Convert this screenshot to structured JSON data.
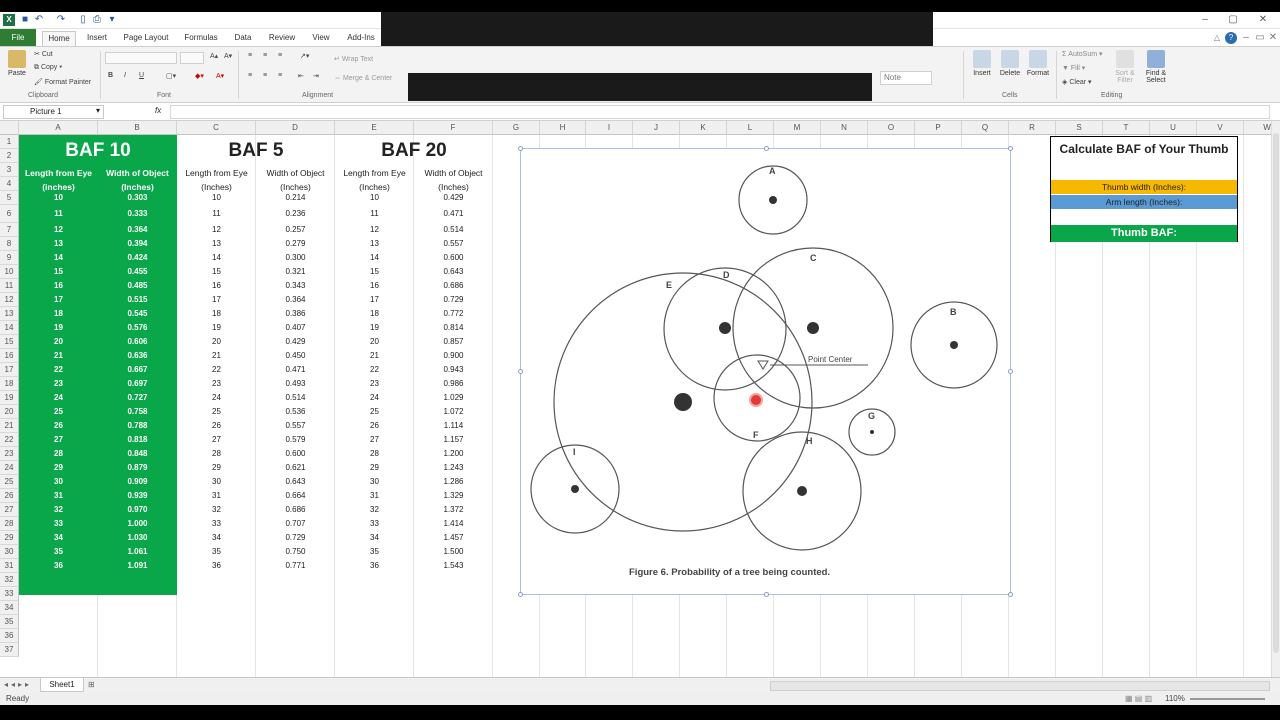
{
  "ribbon": {
    "tabs": [
      "File",
      "Home",
      "Insert",
      "Page Layout",
      "Formulas",
      "Data",
      "Review",
      "View",
      "Add-Ins"
    ],
    "clipboard": {
      "paste": "Paste",
      "cut": "Cut",
      "copy": "Copy",
      "format_painter": "Format Painter",
      "label": "Clipboard"
    },
    "font_label": "Font",
    "alignment": {
      "wrap": "Wrap Text",
      "merge": "Merge & Center",
      "label": "Alignment"
    },
    "number_note": "Note",
    "cells": {
      "insert": "Insert",
      "delete": "Delete",
      "format": "Format",
      "label": "Cells"
    },
    "editing": {
      "autosum": "AutoSum",
      "fill": "Fill",
      "clear": "Clear",
      "sort": "Sort & Filter",
      "find": "Find & Select",
      "label": "Editing"
    }
  },
  "formula": {
    "namebox": "Picture 1",
    "fx": "fx"
  },
  "columns": [
    "A",
    "B",
    "C",
    "D",
    "E",
    "F",
    "G",
    "H",
    "I",
    "J",
    "K",
    "L",
    "M",
    "N",
    "O",
    "P",
    "Q",
    "R",
    "S",
    "T",
    "U",
    "V",
    "W"
  ],
  "rows": [
    "1",
    "2",
    "3",
    "4",
    "5",
    "6",
    "7",
    "8",
    "9",
    "10",
    "11",
    "12",
    "13",
    "14",
    "15",
    "16",
    "17",
    "18",
    "19",
    "20",
    "21",
    "22",
    "23",
    "24",
    "25",
    "26",
    "27",
    "28",
    "29",
    "30",
    "31",
    "32",
    "33",
    "34",
    "35",
    "36",
    "37"
  ],
  "tables": {
    "baf10": {
      "title": "BAF 10",
      "h1": "Length from Eye",
      "h2": "Width of Object",
      "unit": "(inches)",
      "unit2": "(Inches)"
    },
    "baf5": {
      "title": "BAF 5",
      "h1": "Length from Eye",
      "h2": "Width of Object",
      "unit": "(Inches)",
      "unit2": "(Inches)"
    },
    "baf20": {
      "title": "BAF 20",
      "h1": "Length from Eye",
      "h2": "Width of Object",
      "unit": "(Inches)",
      "unit2": "(Inches)"
    },
    "lengths": [
      "10",
      "11",
      "12",
      "13",
      "14",
      "15",
      "16",
      "17",
      "18",
      "19",
      "20",
      "21",
      "22",
      "23",
      "24",
      "25",
      "26",
      "27",
      "28",
      "29",
      "30",
      "31",
      "32",
      "33",
      "34",
      "35",
      "36"
    ],
    "w10": [
      "0.303",
      "0.333",
      "0.364",
      "0.394",
      "0.424",
      "0.455",
      "0.485",
      "0.515",
      "0.545",
      "0.576",
      "0.606",
      "0.636",
      "0.667",
      "0.697",
      "0.727",
      "0.758",
      "0.788",
      "0.818",
      "0.848",
      "0.879",
      "0.909",
      "0.939",
      "0.970",
      "1.000",
      "1.030",
      "1.061",
      "1.091"
    ],
    "w5": [
      "0.214",
      "0.236",
      "0.257",
      "0.279",
      "0.300",
      "0.321",
      "0.343",
      "0.364",
      "0.386",
      "0.407",
      "0.429",
      "0.450",
      "0.471",
      "0.493",
      "0.514",
      "0.536",
      "0.557",
      "0.579",
      "0.600",
      "0.621",
      "0.643",
      "0.664",
      "0.686",
      "0.707",
      "0.729",
      "0.750",
      "0.771"
    ],
    "w20": [
      "0.429",
      "0.471",
      "0.514",
      "0.557",
      "0.600",
      "0.643",
      "0.686",
      "0.729",
      "0.772",
      "0.814",
      "0.857",
      "0.900",
      "0.943",
      "0.986",
      "1.029",
      "1.072",
      "1.114",
      "1.157",
      "1.200",
      "1.243",
      "1.286",
      "1.329",
      "1.372",
      "1.414",
      "1.457",
      "1.500",
      "1.543"
    ]
  },
  "figure": {
    "caption": "Figure 6. Probability of a tree being counted.",
    "point_center": "Point Center",
    "letters": [
      "A",
      "B",
      "C",
      "D",
      "E",
      "F",
      "G",
      "H",
      "I"
    ]
  },
  "calc": {
    "title": "Calculate BAF of Your Thumb",
    "thumb": "Thumb width (Inches):",
    "arm": "Arm length (Inches):",
    "result": "Thumb BAF:",
    "orange": "#f6b800",
    "blue": "#5b9bd5",
    "green": "#0aa64a"
  },
  "status": {
    "ready": "Ready",
    "sheet": "Sheet1",
    "zoom": "110%"
  }
}
